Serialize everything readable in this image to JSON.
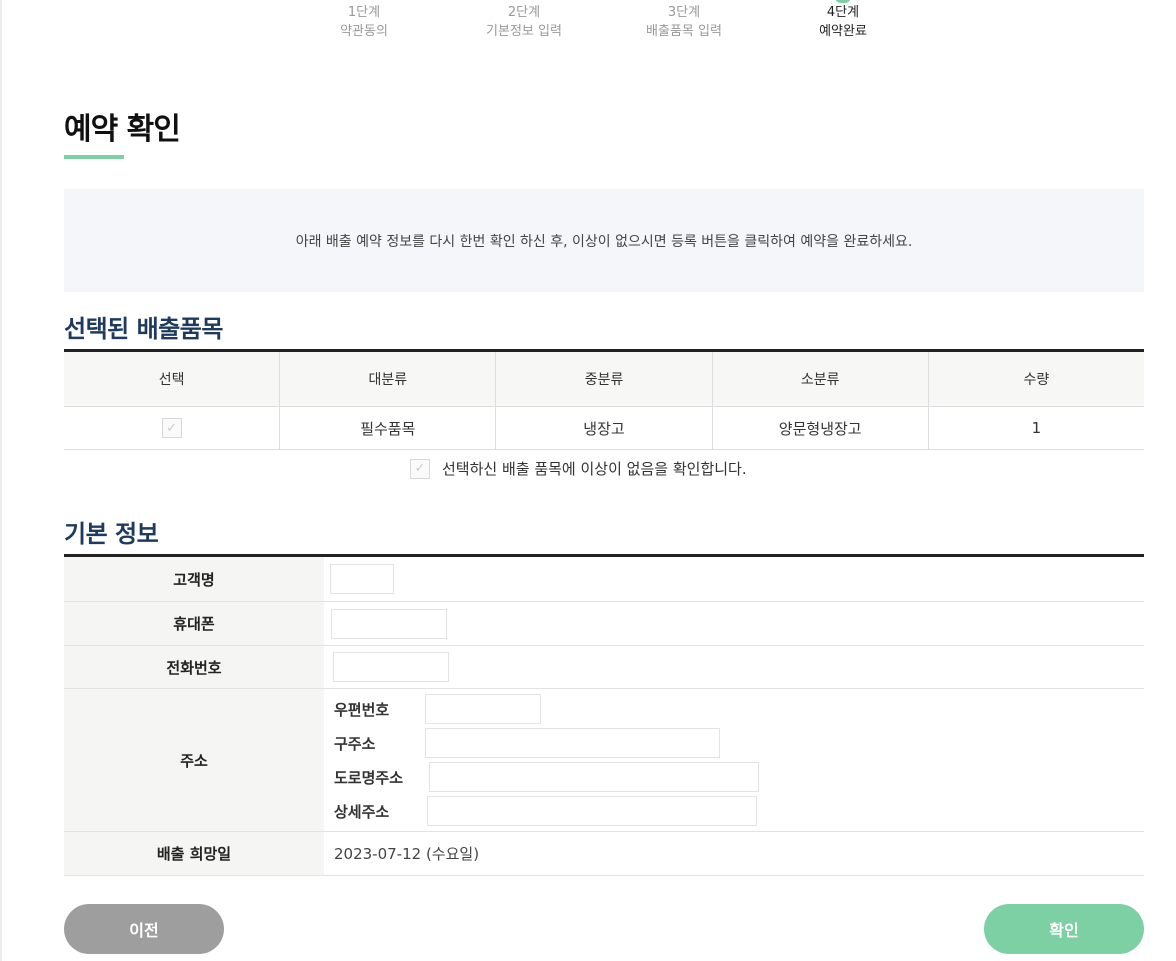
{
  "steps": [
    {
      "num": "1단계",
      "label": "약관동의",
      "active": false
    },
    {
      "num": "2단계",
      "label": "기본정보 입력",
      "active": false
    },
    {
      "num": "3단계",
      "label": "배출품목 입력",
      "active": false
    },
    {
      "num": "4단계",
      "label": "예약완료",
      "active": true
    }
  ],
  "page_title": "예약 확인",
  "notice": "아래 배출 예약 정보를 다시 한번 확인 하신 후, 이상이 없으시면 등록 버튼을 클릭하여 예약을 완료하세요.",
  "items_section": {
    "title": "선택된 배출품목",
    "headers": [
      "선택",
      "대분류",
      "중분류",
      "소분류",
      "수량"
    ],
    "rows": [
      {
        "checked": true,
        "major": "필수품목",
        "middle": "냉장고",
        "minor": "양문형냉장고",
        "qty": "1"
      }
    ],
    "confirm_text": "선택하신 배출 품목에 이상이 없음을 확인합니다."
  },
  "info_section": {
    "title": "기본 정보",
    "customer_label": "고객명",
    "customer_value": "",
    "mobile_label": "휴대폰",
    "mobile_value": "",
    "phone_label": "전화번호",
    "phone_value": "",
    "address_label": "주소",
    "zip_label": "우편번호",
    "old_addr_label": "구주소",
    "road_addr_label": "도로명주소",
    "detail_addr_label": "상세주소",
    "date_label": "배출 희망일",
    "date_value": "2023-07-12 (수요일)"
  },
  "buttons": {
    "prev": "이전",
    "ok": "확인"
  },
  "colors": {
    "accent": "#7dcfa4",
    "section_title": "#1e3a5f",
    "prev_button": "#9e9e9e"
  }
}
